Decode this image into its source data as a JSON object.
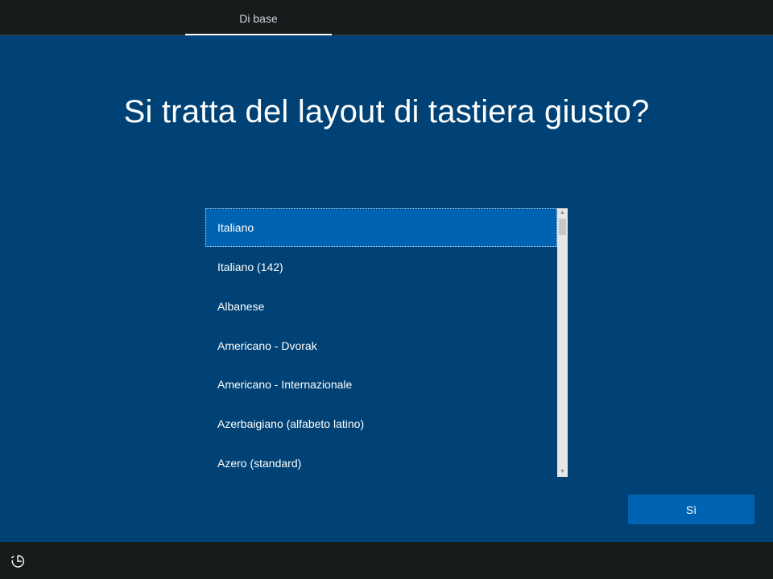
{
  "header": {
    "active_tab": "Di base"
  },
  "main": {
    "title": "Si tratta del layout di tastiera giusto?",
    "keyboard_layouts": [
      {
        "label": "Italiano",
        "selected": true
      },
      {
        "label": "Italiano (142)",
        "selected": false
      },
      {
        "label": "Albanese",
        "selected": false
      },
      {
        "label": "Americano - Dvorak",
        "selected": false
      },
      {
        "label": "Americano - Internazionale",
        "selected": false
      },
      {
        "label": "Azerbaigiano (alfabeto latino)",
        "selected": false
      },
      {
        "label": "Azero (standard)",
        "selected": false
      }
    ],
    "primary_button_label": "Sì"
  },
  "footer": {
    "accessibility_icon": "ease-of-access-icon"
  },
  "colors": {
    "background": "#004275",
    "accent": "#0063b1",
    "bar": "#181b1c"
  }
}
